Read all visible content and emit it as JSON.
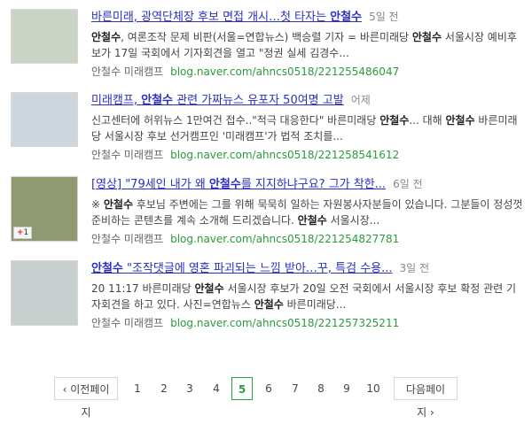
{
  "results": [
    {
      "title_pre": "바른미래, 광역단체장 후보 면접 개시…첫 타자는 ",
      "title_kw": "안철수",
      "title_post": "",
      "age": "5일 전",
      "desc_parts": [
        {
          "t": "안철수",
          "b": true
        },
        {
          "t": ", 여론조작 문제 비판(서울=연합뉴스) 백승렬 기자 = 바른미래당 ",
          "b": false
        },
        {
          "t": "안철수",
          "b": true
        },
        {
          "t": " 서울시장 예비후보가 17일 국회에서 기자회견을 열고 \"정권 실세 김경수...",
          "b": false
        }
      ],
      "source": "안철수 미래캠프",
      "url": "blog.naver.com/ahncs0518/221255486047",
      "thumb_color": "#c9d4c4"
    },
    {
      "title_pre": "미래캠프, ",
      "title_kw": "안철수",
      "title_post": " 관련 가짜뉴스 유포자 50여명 고발",
      "age": "어제",
      "desc_parts": [
        {
          "t": "신고센터에 허위뉴스 1만여건 접수..\"적극 대응한다\" 바른미래당 ",
          "b": false
        },
        {
          "t": "안철수",
          "b": true
        },
        {
          "t": "... 대해 ",
          "b": false
        },
        {
          "t": "안철수",
          "b": true
        },
        {
          "t": " 바른미래당 서울시장 후보 선거캠프인 '미래캠프'가 법적 조치를...",
          "b": false
        }
      ],
      "source": "안철수 미래캠프",
      "url": "blog.naver.com/ahncs0518/221258541612",
      "thumb_color": "#cdd6dc"
    },
    {
      "title_pre": "[영상] \"79세인 내가 왜 ",
      "title_kw": "안철수",
      "title_post": "를 지지하냐구요? 그가 착한...",
      "age": "6일 전",
      "desc_parts": [
        {
          "t": "※ ",
          "b": false
        },
        {
          "t": "안철수",
          "b": true
        },
        {
          "t": " 후보님 주변에는 그를 위해 묵묵히 일하는 자원봉사자분들이 있습니다. 그분들이 정성껏 준비하는 콘텐츠를 계속 소개해 드리겠습니다. ",
          "b": false
        },
        {
          "t": "안철수",
          "b": true
        },
        {
          "t": " 서울시장...",
          "b": false
        }
      ],
      "source": "안철수 미래캠프",
      "url": "blog.naver.com/ahncs0518/221254827781",
      "thumb_color": "#8f9a72",
      "badge": "1"
    },
    {
      "title_pre": "",
      "title_kw": "안철수",
      "title_post": " \"조작댓글에 영혼 파괴되는 느낌 받아…꾸, 특검 수용...",
      "age": "3일 전",
      "desc_parts": [
        {
          "t": "20 11:17 바른미래당 ",
          "b": false
        },
        {
          "t": "안철수",
          "b": true
        },
        {
          "t": " 서울시장 후보가 20일 오전 국회에서 서울시장 후보 확정 관련 기자회견을 하고 있다. 사진=연합뉴스 ",
          "b": false
        },
        {
          "t": "안철수",
          "b": true
        },
        {
          "t": " 바른미래당...",
          "b": false
        }
      ],
      "source": "안철수 미래캠프",
      "url": "blog.naver.com/ahncs0518/221257325211",
      "thumb_color": "#c7d0cf"
    }
  ],
  "pagination": {
    "prev_label": "이전페이지",
    "next_label": "다음페이지",
    "pages": [
      "1",
      "2",
      "3",
      "4",
      "5",
      "6",
      "7",
      "8",
      "9",
      "10"
    ],
    "current": "5",
    "prev_icon": "chevron-left-icon",
    "next_icon": "chevron-right-icon"
  },
  "colors": {
    "title": "#2a2fc0",
    "url": "#2b9a3e",
    "current_page": "#2ba04a"
  }
}
